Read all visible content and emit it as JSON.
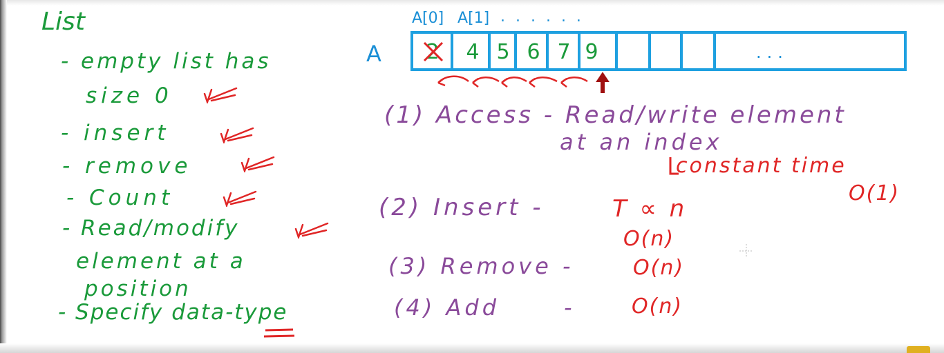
{
  "left_list": {
    "title": "List",
    "items": [
      {
        "line1": "- empty list has",
        "line2": "size 0"
      },
      {
        "line1": "- insert"
      },
      {
        "line1": "- remove"
      },
      {
        "line1": "- Count"
      },
      {
        "line1": "- Read/modify",
        "line2": "element at a",
        "line3": "position"
      },
      {
        "line1": "- Specify data-type"
      }
    ]
  },
  "array": {
    "name": "A",
    "index_labels": [
      "A[0]",
      "A[1]",
      ". . . . . ."
    ],
    "cells": [
      "2",
      "4",
      "5",
      "6",
      "7",
      "9",
      "",
      "",
      "",
      "...",
      ""
    ],
    "crossed_cell": "2"
  },
  "operations": [
    {
      "label": "(1) Access - Read/write element",
      "label2": "at an index",
      "note": "constant time",
      "complexity": "O(1)"
    },
    {
      "label": "(2) Insert -",
      "note": "T ∝ n",
      "complexity": "O(n)"
    },
    {
      "label": "(3) Remove -",
      "complexity": "O(n)"
    },
    {
      "label": "(4) Add",
      "dash": "-",
      "complexity": "O(n)"
    }
  ],
  "colors": {
    "green": "#1a9a3a",
    "purple": "#8a4a9a",
    "red": "#e02626",
    "blue": "#1a8fd6"
  }
}
